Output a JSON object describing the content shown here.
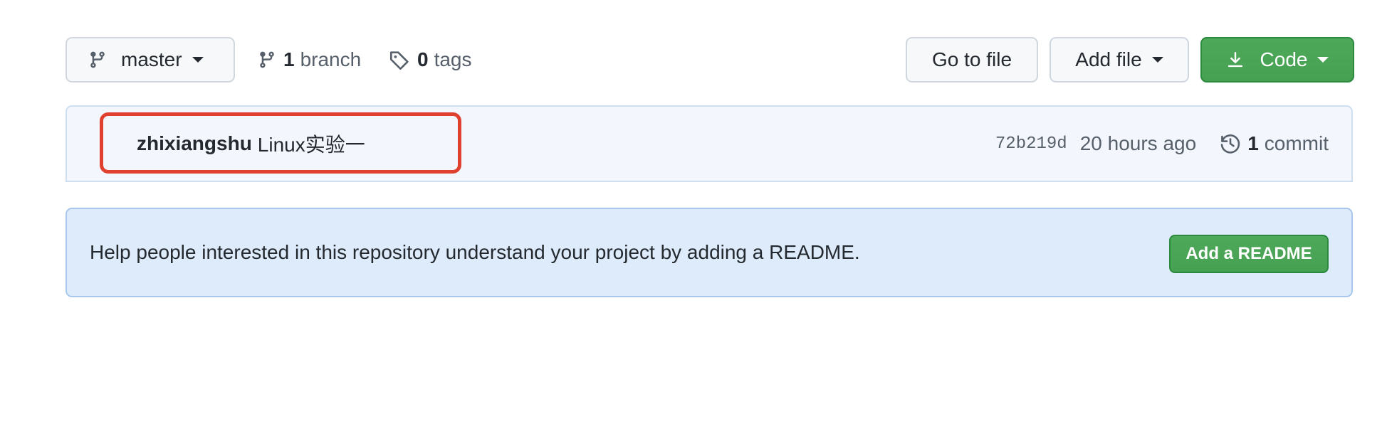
{
  "toolbar": {
    "branch_select": {
      "label": "master",
      "icon": "git-branch-icon"
    },
    "branches": {
      "count": "1",
      "label": "branch",
      "icon": "git-branch-icon"
    },
    "tags": {
      "count": "0",
      "label": "tags",
      "icon": "tag-icon"
    },
    "go_to_file_label": "Go to file",
    "add_file_label": "Add file",
    "code_label": "Code",
    "code_icon": "download-icon"
  },
  "latest_commit": {
    "author": "zhixiangshu",
    "message": "Linux实验一",
    "sha": "72b219d",
    "time": "20 hours ago",
    "commit_count": "1",
    "commit_label": "commit",
    "history_icon": "history-icon",
    "highlight_color": "#e0412f"
  },
  "readme_prompt": {
    "text": "Help people interested in this repository understand your project by adding a README.",
    "button_label": "Add a README"
  },
  "colors": {
    "primary_green": "#2da44e",
    "readme_background": "#ddebfb",
    "commit_background": "#f3f7fd"
  }
}
